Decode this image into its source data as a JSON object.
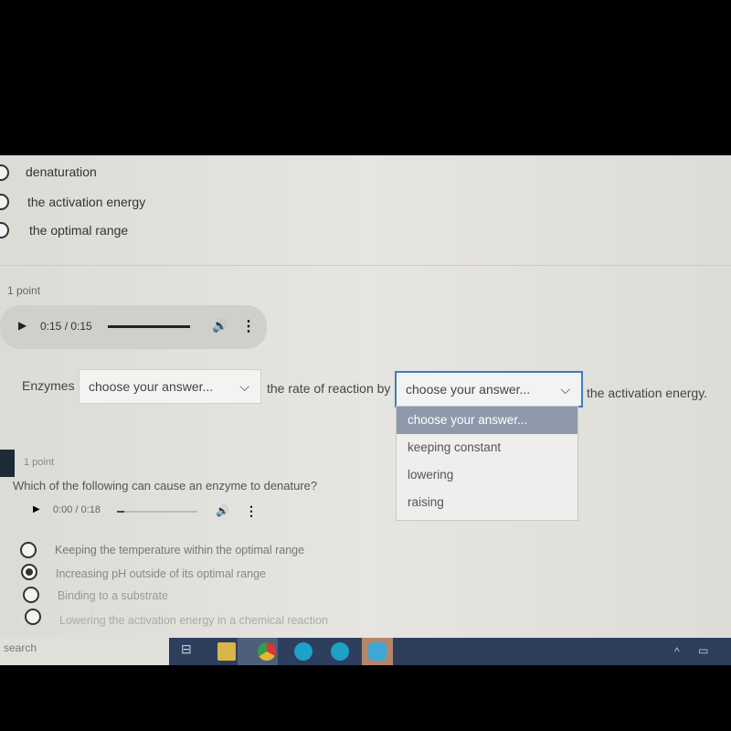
{
  "q1_options": [
    "denaturation",
    "the activation energy",
    "the optimal range"
  ],
  "q2": {
    "points": "1 point",
    "audio_time": "0:15 / 0:15",
    "audio_progress": 1.0,
    "sentence": [
      "Enzymes",
      "the rate of reaction by",
      "the activation energy."
    ],
    "select1": "choose your answer...",
    "select2": "choose your answer...",
    "dropdown_options": [
      "choose your answer...",
      "keeping constant",
      "lowering",
      "raising"
    ]
  },
  "q3": {
    "points": "1 point",
    "question": "Which of the following can cause an enzyme to denature?",
    "audio_time": "0:00 / 0:18",
    "audio_progress": 0.02,
    "options": [
      "Keeping the temperature within the optimal range",
      "Increasing pH outside of its optimal range",
      "Binding to a substrate",
      "Lowering the activation energy in a chemical reaction"
    ],
    "selected": 1
  },
  "taskbar": {
    "search": "search",
    "icons": [
      "task-view",
      "file-explorer",
      "chrome",
      "edge",
      "edge",
      "zoom"
    ]
  }
}
